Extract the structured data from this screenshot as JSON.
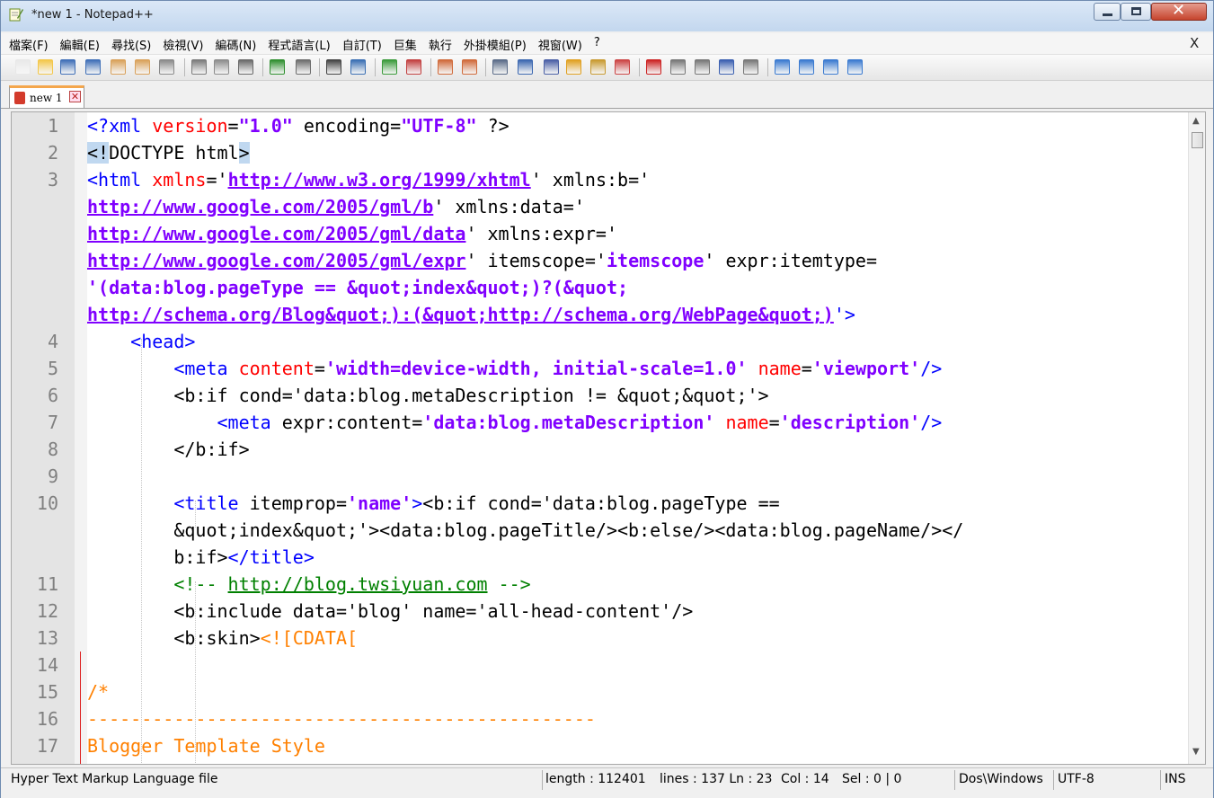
{
  "window": {
    "title": "*new 1 - Notepad++"
  },
  "menu": {
    "items": [
      "檔案(F)",
      "編輯(E)",
      "尋找(S)",
      "檢視(V)",
      "編碼(N)",
      "程式語言(L)",
      "自訂(T)",
      "巨集",
      "執行",
      "外掛模組(P)",
      "視窗(W)",
      "?"
    ],
    "close_glyph": "X"
  },
  "toolbar": {
    "icons": [
      "new-file-icon",
      "open-file-icon",
      "save-icon",
      "save-all-icon",
      "close-icon",
      "close-all-icon",
      "print-icon",
      "cut-icon",
      "copy-icon",
      "paste-icon",
      "undo-icon",
      "redo-icon",
      "find-icon",
      "replace-icon",
      "zoom-in-icon",
      "zoom-out-icon",
      "sync-vertical-icon",
      "sync-horizontal-icon",
      "word-wrap-icon",
      "show-all-chars-icon",
      "indent-guide-icon",
      "doc-map-icon",
      "function-list-icon",
      "launch-browser-icon",
      "record-macro-icon",
      "stop-record-icon",
      "play-macro-icon",
      "run-macro-multiple-icon",
      "save-macro-icon",
      "fold-all-icon",
      "up-icon",
      "down-icon",
      "unfold-all-icon"
    ]
  },
  "tab": {
    "label": "new 1",
    "close_glyph": "✕"
  },
  "editor": {
    "lines": [
      {
        "num": "1",
        "segments": [
          [
            "b",
            "<?xml "
          ],
          [
            "attr",
            "version"
          ],
          [
            "",
            "="
          ],
          [
            "val",
            "\"1.0\""
          ],
          [
            "",
            " encoding="
          ],
          [
            "val",
            "\"UTF-8\""
          ],
          [
            "",
            " ?>"
          ]
        ]
      },
      {
        "num": "2",
        "segments": [
          [
            "hl",
            "<!"
          ],
          [
            "",
            "DOCTYPE html"
          ],
          [
            "hl",
            ">"
          ]
        ]
      },
      {
        "num": "3",
        "segments": [
          [
            "b",
            "<html "
          ],
          [
            "attr",
            "xmlns"
          ],
          [
            "",
            "='"
          ],
          [
            "url",
            "http://www.w3.org/1999/xhtml"
          ],
          [
            "",
            "' xmlns:b='"
          ]
        ]
      },
      {
        "num": "",
        "segments": [
          [
            "url",
            "http://www.google.com/2005/gml/b"
          ],
          [
            "",
            "' xmlns:data='"
          ]
        ]
      },
      {
        "num": "",
        "segments": [
          [
            "url",
            "http://www.google.com/2005/gml/data"
          ],
          [
            "",
            "' xmlns:expr='"
          ]
        ]
      },
      {
        "num": "",
        "segments": [
          [
            "url",
            "http://www.google.com/2005/gml/expr"
          ],
          [
            "",
            "' itemscope='"
          ],
          [
            "val",
            "itemscope"
          ],
          [
            "",
            "' expr:itemtype="
          ]
        ]
      },
      {
        "num": "",
        "segments": [
          [
            "val",
            "'(data:blog.pageType == &quot;index&quot;)?(&quot;"
          ]
        ]
      },
      {
        "num": "",
        "segments": [
          [
            "url",
            "http://schema.org/Blog&quot;):(&quot;http://schema.org/WebPage&quot;)"
          ],
          [
            "b",
            "'>"
          ]
        ]
      },
      {
        "num": "4",
        "segments": [
          [
            "",
            "    "
          ],
          [
            "b",
            "<head>"
          ]
        ]
      },
      {
        "num": "5",
        "segments": [
          [
            "",
            "        "
          ],
          [
            "b",
            "<meta "
          ],
          [
            "attr",
            "content"
          ],
          [
            "",
            "="
          ],
          [
            "val",
            "'width=device-width, initial-scale=1.0'"
          ],
          [
            "",
            " "
          ],
          [
            "attr",
            "name"
          ],
          [
            "",
            "="
          ],
          [
            "val",
            "'viewport'"
          ],
          [
            "b",
            "/>"
          ]
        ]
      },
      {
        "num": "6",
        "segments": [
          [
            "",
            "        <b:if cond='data:blog.metaDescription != &quot;&quot;'>"
          ]
        ]
      },
      {
        "num": "7",
        "segments": [
          [
            "",
            "            "
          ],
          [
            "b",
            "<meta "
          ],
          [
            "",
            "expr:content="
          ],
          [
            "val",
            "'data:blog.metaDescription'"
          ],
          [
            "",
            " "
          ],
          [
            "attr",
            "name"
          ],
          [
            "",
            "="
          ],
          [
            "val",
            "'description'"
          ],
          [
            "b",
            "/>"
          ]
        ]
      },
      {
        "num": "8",
        "segments": [
          [
            "",
            "        </b:if>"
          ]
        ]
      },
      {
        "num": "9",
        "segments": [
          [
            "",
            ""
          ]
        ]
      },
      {
        "num": "10",
        "segments": [
          [
            "",
            "        "
          ],
          [
            "b",
            "<title "
          ],
          [
            "",
            "itemprop="
          ],
          [
            "val",
            "'name'"
          ],
          [
            "b",
            ">"
          ],
          [
            "",
            "<b:if cond='data:blog.pageType =="
          ]
        ]
      },
      {
        "num": "",
        "segments": [
          [
            "",
            "        &quot;index&quot;'><data:blog.pageTitle/><b:else/><data:blog.pageName/></"
          ]
        ]
      },
      {
        "num": "",
        "segments": [
          [
            "",
            "        b:if>"
          ],
          [
            "b",
            "</title>"
          ]
        ]
      },
      {
        "num": "11",
        "segments": [
          [
            "",
            "        "
          ],
          [
            "com",
            "<!-- "
          ],
          [
            "comu",
            "http://blog.twsiyuan.com"
          ],
          [
            "com",
            " -->"
          ]
        ]
      },
      {
        "num": "12",
        "segments": [
          [
            "",
            "        <b:include data='blog' name='all-head-content'/>"
          ]
        ]
      },
      {
        "num": "13",
        "segments": [
          [
            "",
            "        <b:skin>"
          ],
          [
            "cd",
            "<![CDATA["
          ]
        ]
      },
      {
        "num": "14",
        "segments": [
          [
            "",
            ""
          ]
        ]
      },
      {
        "num": "15",
        "segments": [
          [
            "cd",
            "/*"
          ]
        ]
      },
      {
        "num": "16",
        "segments": [
          [
            "cd",
            "-----------------------------------------------"
          ]
        ]
      },
      {
        "num": "17",
        "segments": [
          [
            "cd",
            "Blogger Template Style"
          ]
        ]
      }
    ]
  },
  "status": {
    "file_type": "Hyper Text Markup Language file",
    "length": "length : 112401",
    "lines_pos": "lines : 137   Ln : 23",
    "col": "Col : 14",
    "sel": "Sel : 0 | 0",
    "eol": "Dos\\Windows",
    "encoding": "UTF-8",
    "mode": "INS"
  }
}
